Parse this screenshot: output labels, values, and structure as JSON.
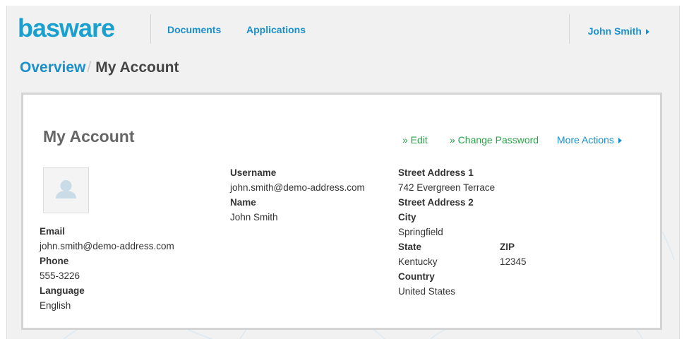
{
  "header": {
    "logo_text": "basware",
    "nav": [
      "Documents",
      "Applications"
    ],
    "user_name": "John Smith"
  },
  "breadcrumb": {
    "parent": "Overview",
    "separator": "/",
    "current": "My Account"
  },
  "account": {
    "title": "My Account",
    "actions": {
      "edit": "» Edit",
      "change_password": "» Change Password",
      "more_actions": "More Actions"
    },
    "labels": {
      "email": "Email",
      "phone": "Phone",
      "language": "Language",
      "username": "Username",
      "name": "Name",
      "street1": "Street Address 1",
      "street2": "Street Address 2",
      "city": "City",
      "state": "State",
      "zip": "ZIP",
      "country": "Country"
    },
    "values": {
      "email": "john.smith@demo-address.com",
      "phone": "555-3226",
      "language": "English",
      "username": "john.smith@demo-address.com",
      "name": "John Smith",
      "street1": "742 Evergreen Terrace",
      "street2": "",
      "city": "Springfield",
      "state": "Kentucky",
      "zip": "12345",
      "country": "United States"
    }
  },
  "colors": {
    "accent": "#1a8fc9",
    "logo": "#1aa0cf",
    "action_green": "#2aa24a",
    "background": "#f1f1f1"
  }
}
